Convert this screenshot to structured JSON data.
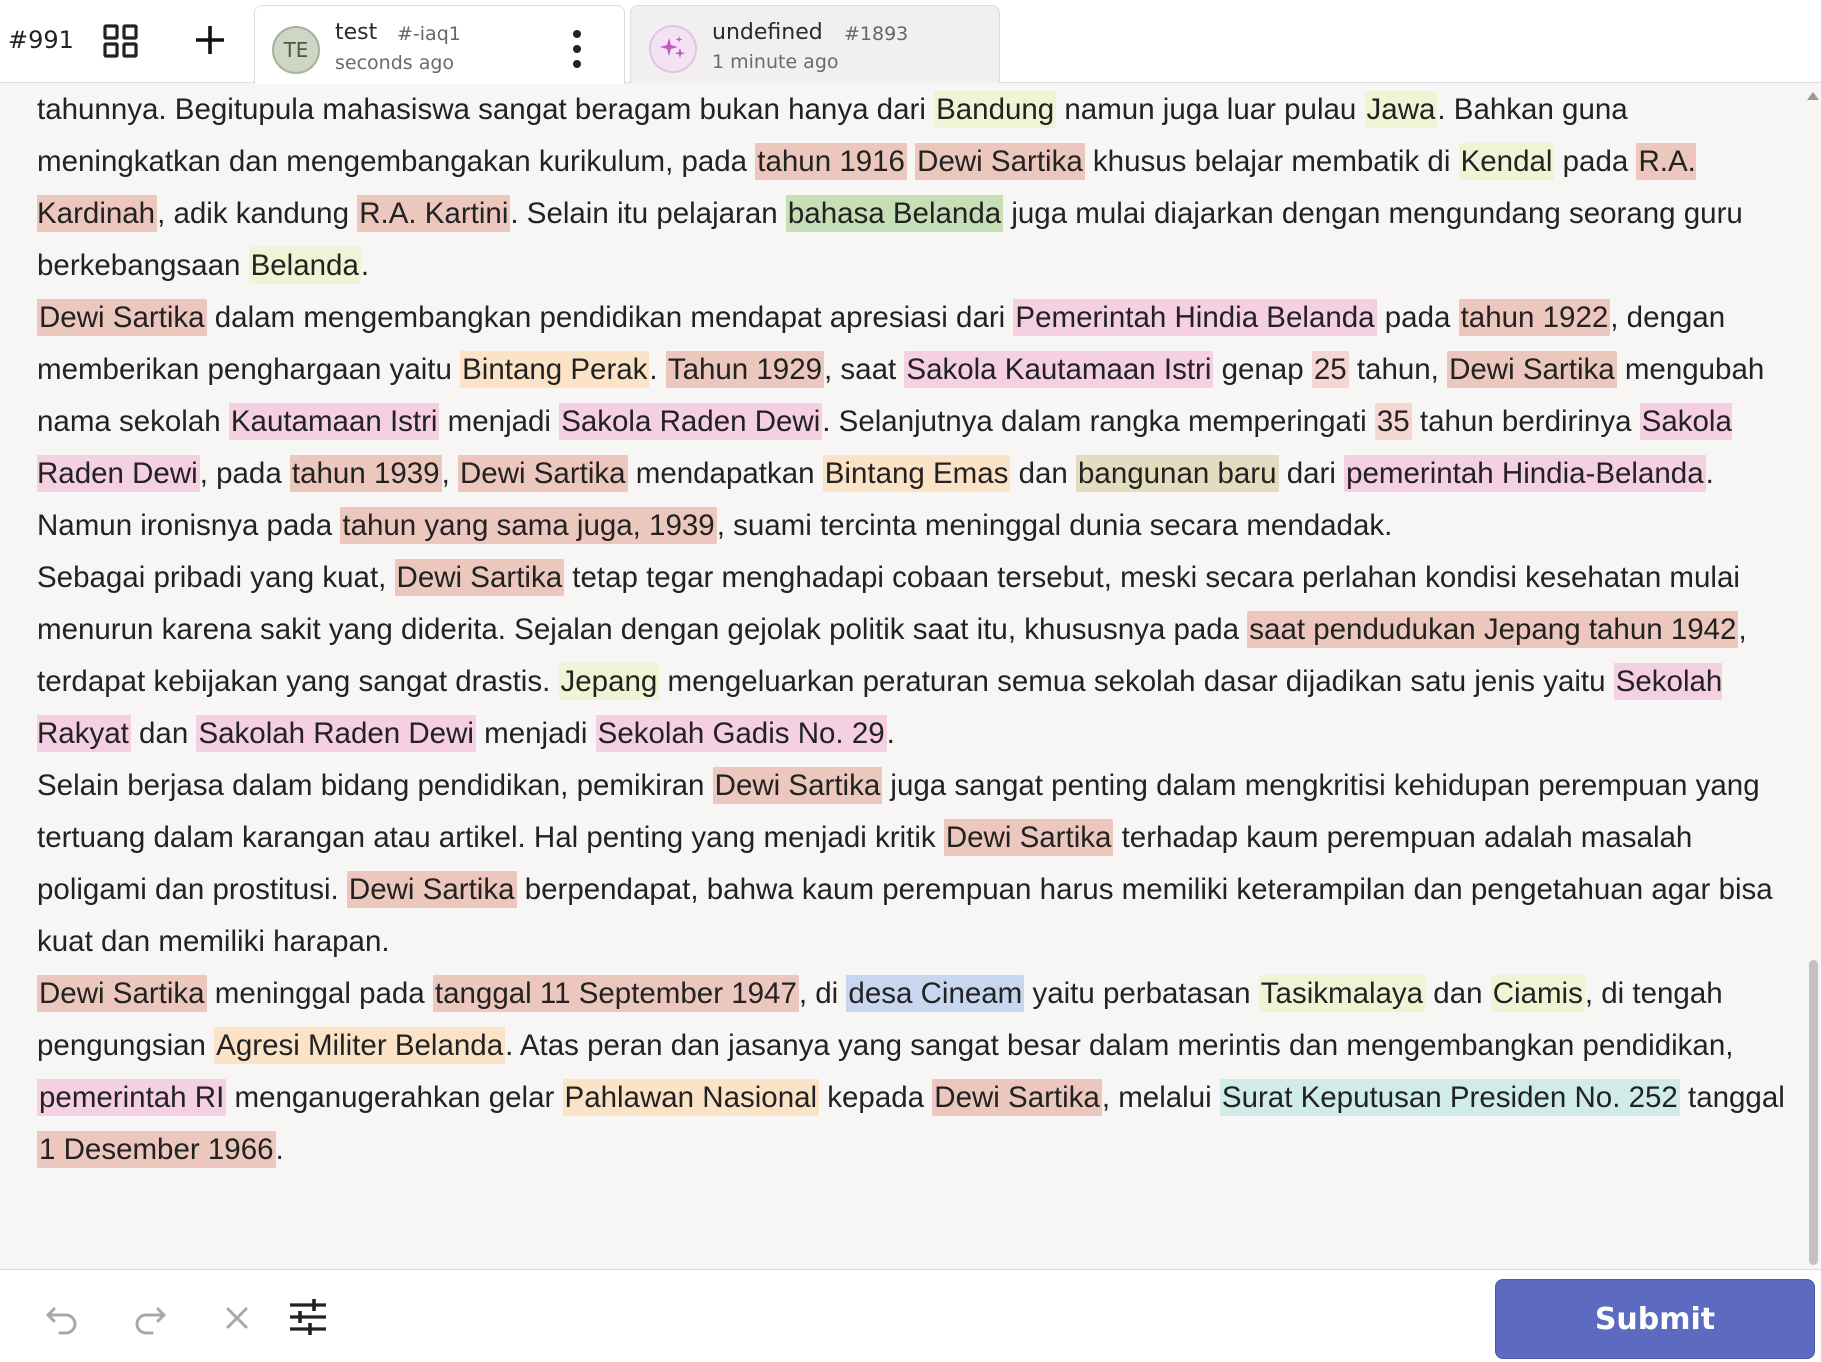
{
  "header": {
    "task_id": "#991",
    "tabs": [
      {
        "title": "test",
        "id": "#-iaq1",
        "time": "seconds ago",
        "avatar_initials": "TE"
      },
      {
        "title": "undefined",
        "id": "#1893",
        "time": "1 minute ago",
        "avatar_icon": "sparkle-icon"
      }
    ]
  },
  "colors": {
    "accent": "#5c6bc0",
    "location": "#eef5d4",
    "person": "#ecc7bd",
    "language": "#c7dfb6",
    "organization": "#f5cfe2",
    "award": "#fbe3c8",
    "facility": "#c8d6f0",
    "law": "#cfece8"
  },
  "document": {
    "paragraphs": [
      [
        {
          "t": "tahunnya. Begitupula mahasiswa sangat beragam bukan hanya dari "
        },
        {
          "t": "Bandung",
          "c": "loc"
        },
        {
          "t": " namun juga luar pulau "
        },
        {
          "t": "Jawa",
          "c": "loc"
        },
        {
          "t": ". Bahkan guna meningkatkan dan mengembangakan kurikulum, pada "
        },
        {
          "t": "tahun 1916",
          "c": "date"
        },
        {
          "t": " "
        },
        {
          "t": "Dewi Sartika",
          "c": "per"
        },
        {
          "t": " khusus belajar membatik di "
        },
        {
          "t": "Kendal",
          "c": "loc"
        },
        {
          "t": " pada "
        },
        {
          "t": "R.A. Kardinah",
          "c": "per"
        },
        {
          "t": ", adik kandung "
        },
        {
          "t": "R.A. Kartini",
          "c": "per"
        },
        {
          "t": ". Selain itu pelajaran "
        },
        {
          "t": "bahasa Belanda",
          "c": "lang"
        },
        {
          "t": " juga mulai diajarkan dengan mengundang seorang guru berkebangsaan "
        },
        {
          "t": "Belanda",
          "c": "loc"
        },
        {
          "t": "."
        }
      ],
      [
        {
          "t": "Dewi Sartika",
          "c": "per"
        },
        {
          "t": " dalam mengembangkan pendidikan mendapat apresiasi dari "
        },
        {
          "t": "Pemerintah Hindia Belanda",
          "c": "org"
        },
        {
          "t": " pada "
        },
        {
          "t": "tahun 1922",
          "c": "date"
        },
        {
          "t": ", dengan memberikan penghargaan yaitu "
        },
        {
          "t": "Bintang Perak",
          "c": "award"
        },
        {
          "t": ". "
        },
        {
          "t": "Tahun 1929",
          "c": "date"
        },
        {
          "t": ", saat "
        },
        {
          "t": "Sakola Kautamaan Istri",
          "c": "org"
        },
        {
          "t": " genap "
        },
        {
          "t": "25",
          "c": "num"
        },
        {
          "t": " tahun, "
        },
        {
          "t": "Dewi Sartika",
          "c": "per"
        },
        {
          "t": " mengubah nama sekolah "
        },
        {
          "t": "Kautamaan Istri",
          "c": "org"
        },
        {
          "t": " menjadi "
        },
        {
          "t": "Sakola Raden Dewi",
          "c": "org"
        },
        {
          "t": ". Selanjutnya dalam rangka memperingati "
        },
        {
          "t": "35",
          "c": "num"
        },
        {
          "t": " tahun berdirinya "
        },
        {
          "t": "Sakola Raden Dewi",
          "c": "org"
        },
        {
          "t": ", pada "
        },
        {
          "t": "tahun 1939",
          "c": "date"
        },
        {
          "t": ", "
        },
        {
          "t": "Dewi Sartika",
          "c": "per"
        },
        {
          "t": " mendapatkan "
        },
        {
          "t": "Bintang Emas",
          "c": "award"
        },
        {
          "t": " dan "
        },
        {
          "t": "bangunan baru",
          "c": "bld"
        },
        {
          "t": " dari "
        },
        {
          "t": "pemerintah Hindia-Belanda",
          "c": "org"
        },
        {
          "t": ". Namun ironisnya pada "
        },
        {
          "t": "tahun yang sama juga, 1939",
          "c": "date"
        },
        {
          "t": ", suami tercinta meninggal dunia secara mendadak."
        }
      ],
      [
        {
          "t": "Sebagai pribadi yang kuat, "
        },
        {
          "t": "Dewi Sartika",
          "c": "per"
        },
        {
          "t": " tetap tegar menghadapi cobaan tersebut, meski secara perlahan kondisi kesehatan mulai menurun karena sakit yang diderita. Sejalan dengan gejolak politik saat itu, khususnya pada "
        },
        {
          "t": "saat pendudukan Jepang tahun 1942",
          "c": "date"
        },
        {
          "t": ", terdapat kebijakan yang sangat drastis. "
        },
        {
          "t": "Jepang",
          "c": "loc"
        },
        {
          "t": " mengeluarkan peraturan semua sekolah dasar dijadikan satu jenis yaitu "
        },
        {
          "t": "Sekolah Rakyat",
          "c": "org"
        },
        {
          "t": " dan "
        },
        {
          "t": "Sakolah Raden Dewi",
          "c": "org"
        },
        {
          "t": " menjadi "
        },
        {
          "t": "Sekolah Gadis No. 29",
          "c": "org"
        },
        {
          "t": "."
        }
      ],
      [
        {
          "t": "Selain berjasa dalam bidang pendidikan, pemikiran "
        },
        {
          "t": "Dewi Sartika",
          "c": "per"
        },
        {
          "t": " juga sangat penting dalam mengkritisi kehidupan perempuan yang tertuang dalam karangan atau artikel. Hal penting yang menjadi kritik "
        },
        {
          "t": "Dewi Sartika",
          "c": "per"
        },
        {
          "t": " terhadap kaum perempuan adalah masalah poligami dan prostitusi. "
        },
        {
          "t": "Dewi Sartika",
          "c": "per"
        },
        {
          "t": " berpendapat, bahwa kaum perempuan harus memiliki keterampilan dan pengetahuan agar bisa kuat dan memiliki harapan."
        }
      ],
      [
        {
          "t": "Dewi Sartika",
          "c": "per"
        },
        {
          "t": " meninggal pada "
        },
        {
          "t": "tanggal 11 September 1947",
          "c": "date"
        },
        {
          "t": ", di "
        },
        {
          "t": "desa Cineam",
          "c": "fac"
        },
        {
          "t": " yaitu perbatasan "
        },
        {
          "t": "Tasikmalaya",
          "c": "loc"
        },
        {
          "t": " dan "
        },
        {
          "t": "Ciamis",
          "c": "loc"
        },
        {
          "t": ", di tengah pengungsian "
        },
        {
          "t": "Agresi Militer Belanda",
          "c": "award"
        },
        {
          "t": ". Atas peran dan jasanya yang sangat besar dalam merintis dan mengembangkan pendidikan, "
        },
        {
          "t": "pemerintah RI",
          "c": "org"
        },
        {
          "t": " menganugerahkan gelar "
        },
        {
          "t": "Pahlawan Nasional",
          "c": "award"
        },
        {
          "t": " kepada "
        },
        {
          "t": "Dewi Sartika",
          "c": "per"
        },
        {
          "t": ", melalui "
        },
        {
          "t": "Surat Keputusan Presiden No. 252",
          "c": "law"
        },
        {
          "t": " tanggal "
        },
        {
          "t": "1 Desember 1966",
          "c": "date"
        },
        {
          "t": "."
        }
      ]
    ]
  },
  "footer": {
    "undo_icon": "undo-icon",
    "redo_icon": "redo-icon",
    "clear_icon": "close-icon",
    "settings_icon": "sliders-icon",
    "submit_label": "Submit"
  }
}
